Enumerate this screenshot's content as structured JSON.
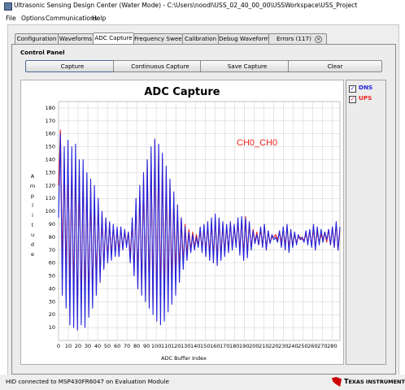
{
  "window": {
    "title": "Ultrasonic Sensing Design Center (Water Mode) - C:\\Users\\noodl\\USS_02_40_00_00\\USSWorkspace\\USS_Project"
  },
  "menu": [
    "File",
    "Options",
    "Communications",
    "Help"
  ],
  "tabs": [
    "Configuration",
    "Waveforms",
    "ADC Capture",
    "Frequency Sweep",
    "Calibration",
    "Debug Waveform",
    "Errors (117)"
  ],
  "active_tab": "ADC Capture",
  "control_panel": {
    "title": "Control Panel",
    "buttons": [
      "Capture",
      "Continuous Capture",
      "Save Capture",
      "Clear"
    ]
  },
  "chart_data": {
    "type": "line",
    "title": "ADC Capture",
    "annotation": "CH0_CH0",
    "xlabel": "ADC Buffer Index",
    "ylabel": "Amplitude",
    "xlim": [
      0,
      288
    ],
    "ylim": [
      0,
      185
    ],
    "x_ticks": [
      0,
      10,
      20,
      30,
      40,
      50,
      60,
      70,
      80,
      90,
      100,
      110,
      120,
      130,
      140,
      150,
      160,
      170,
      180,
      190,
      200,
      210,
      220,
      230,
      240,
      250,
      260,
      270,
      280
    ],
    "y_ticks": [
      10,
      20,
      30,
      40,
      50,
      60,
      70,
      80,
      90,
      100,
      110,
      120,
      130,
      140,
      150,
      160,
      170,
      180
    ],
    "grid": true,
    "series": [
      {
        "name": "DNS",
        "color": "#2222dd",
        "values": [
          95,
          160,
          35,
          150,
          25,
          155,
          12,
          150,
          10,
          152,
          8,
          140,
          12,
          140,
          10,
          130,
          18,
          125,
          25,
          120,
          35,
          110,
          45,
          100,
          55,
          95,
          60,
          92,
          62,
          90,
          65,
          88,
          65,
          88,
          70,
          86,
          72,
          84,
          60,
          95,
          50,
          110,
          40,
          120,
          35,
          130,
          30,
          140,
          25,
          150,
          20,
          156,
          15,
          152,
          12,
          145,
          15,
          135,
          22,
          125,
          28,
          115,
          35,
          105,
          45,
          95,
          55,
          88,
          62,
          84,
          68,
          82,
          70,
          80,
          72,
          88,
          68,
          90,
          65,
          92,
          62,
          95,
          60,
          98,
          58,
          95,
          62,
          92,
          65,
          90,
          68,
          92,
          70,
          90,
          72,
          95,
          66,
          96,
          62,
          95,
          64,
          92,
          70,
          85,
          75,
          82,
          74,
          88,
          72,
          90,
          70,
          85,
          75,
          82,
          78,
          80,
          76,
          85,
          72,
          88,
          70,
          90,
          68,
          86,
          72,
          84,
          74,
          82,
          78,
          80,
          76,
          85,
          74,
          86,
          72,
          90,
          70,
          88,
          74,
          86,
          76,
          84,
          78,
          86,
          74,
          88,
          72,
          92,
          70,
          88
        ]
      },
      {
        "name": "UPS",
        "color": "#ee2020",
        "values": [
          120,
          163,
          60,
          140,
          50,
          145,
          40,
          140,
          30,
          140,
          20,
          130,
          28,
          130,
          25,
          122,
          30,
          118,
          35,
          110,
          45,
          105,
          50,
          98,
          58,
          94,
          62,
          90,
          66,
          88,
          68,
          86,
          70,
          86,
          72,
          84,
          74,
          84,
          66,
          92,
          55,
          105,
          48,
          115,
          40,
          125,
          35,
          135,
          30,
          145,
          25,
          155,
          28,
          148,
          30,
          140,
          32,
          130,
          38,
          120,
          45,
          110,
          50,
          100,
          55,
          95,
          60,
          90,
          66,
          86,
          70,
          84,
          72,
          82,
          74,
          84,
          72,
          86,
          70,
          88,
          68,
          90,
          66,
          92,
          64,
          94,
          66,
          90,
          68,
          88,
          70,
          90,
          72,
          88,
          74,
          92,
          70,
          94,
          66,
          96,
          68,
          90,
          72,
          86,
          76,
          84,
          74,
          86,
          74,
          88,
          72,
          84,
          76,
          80,
          80,
          82,
          78,
          84,
          76,
          86,
          74,
          88,
          72,
          84,
          74,
          82,
          76,
          80,
          80,
          78,
          78,
          82,
          76,
          84,
          74,
          86,
          72,
          84,
          76,
          82,
          78,
          84,
          76,
          86,
          74,
          88,
          72,
          90,
          70,
          86
        ]
      }
    ]
  },
  "legend": [
    "DNS",
    "UPS"
  ],
  "status": {
    "text": "HID connected to MSP430FR6047 on Evaluation Module",
    "brand": "Texas Instruments"
  },
  "colors": {
    "dns": "#2222dd",
    "ups": "#ee2020",
    "annotation": "#ee2020"
  }
}
